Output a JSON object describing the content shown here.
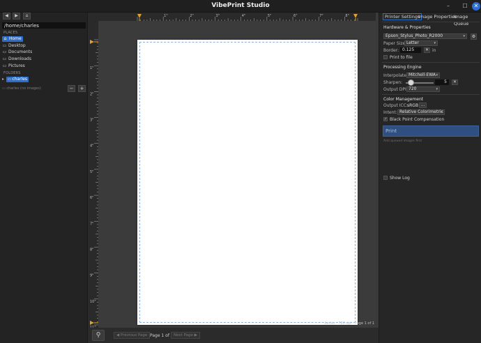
{
  "window": {
    "title": "VibePrint Studio",
    "minimize_glyph": "–",
    "maximize_glyph": "☐",
    "close_glyph": "✕"
  },
  "sidebar": {
    "back_glyph": "◀",
    "forward_glyph": "▶",
    "home_glyph": "⌂",
    "path": "/home/charles",
    "places_label": "PLACES",
    "places": [
      {
        "label": "Home",
        "icon": "home-icon",
        "glyph": "⌂"
      },
      {
        "label": "Desktop",
        "icon": "folder-icon",
        "glyph": "▭"
      },
      {
        "label": "Documents",
        "icon": "folder-icon",
        "glyph": "▭"
      },
      {
        "label": "Downloads",
        "icon": "folder-icon",
        "glyph": "▭"
      },
      {
        "label": "Pictures",
        "icon": "folder-icon",
        "glyph": "▭"
      }
    ],
    "folders_label": "FOLDERS",
    "folder_item": "charles",
    "folder_status": "charles (no images)",
    "minus_glyph": "−",
    "plus_glyph": "+"
  },
  "ruler": {
    "top_labels": [
      "1\"",
      "2\"",
      "3\"",
      "4\"",
      "5\"",
      "6\"",
      "7\"",
      "8\""
    ],
    "left_labels": [
      "1\"",
      "2\"",
      "3\"",
      "4\"",
      "5\"",
      "6\"",
      "7\"",
      "8\"",
      "9\"",
      "10\"",
      "11\""
    ]
  },
  "canvas": {
    "page_info": "Letter · 720 dpi · Page 1 of 1"
  },
  "pager": {
    "prev": "◀ Previous Page",
    "label": "Page 1 of 1",
    "next": "Next Page ▶",
    "zoom_glyph": "⚲"
  },
  "tabs": {
    "printer_settings": "Printer Settings",
    "image_properties": "Image Properties",
    "image_queue": "Image Queue"
  },
  "hardware": {
    "title": "Hardware & Properties",
    "printer": "Epson_Stylus_Photo_R2000",
    "paper_size_label": "Paper Size:",
    "paper_size": "Letter",
    "border_label": "Border:",
    "border_value": "0.125",
    "border_unit": "in",
    "print_to_file": "Print to file"
  },
  "processing": {
    "title": "Processing Engine",
    "interpolate_label": "Interpolate:",
    "interpolate": "Mitchell-EWA",
    "sharpen_label": "Sharpen:",
    "sharpen_value": "5",
    "sharpen_fraction": 0.1,
    "output_dpi_label": "Output DPI:",
    "output_dpi": "720"
  },
  "color": {
    "title": "Color Management",
    "output_icc_label": "Output ICC:",
    "output_icc": "sRGB",
    "browse": "...",
    "intent_label": "Intent:",
    "intent": "Relative Colorimetric",
    "black_point": "Black Point Compensation",
    "black_point_checked": "✓"
  },
  "print": {
    "button": "Print",
    "hint": "Add queued images first"
  },
  "log": {
    "show_log": "Show Log"
  },
  "colors": {
    "accent": "#2e6ec8",
    "print_button": "#2e4f7f",
    "ruler_marker": "#e0a030"
  }
}
